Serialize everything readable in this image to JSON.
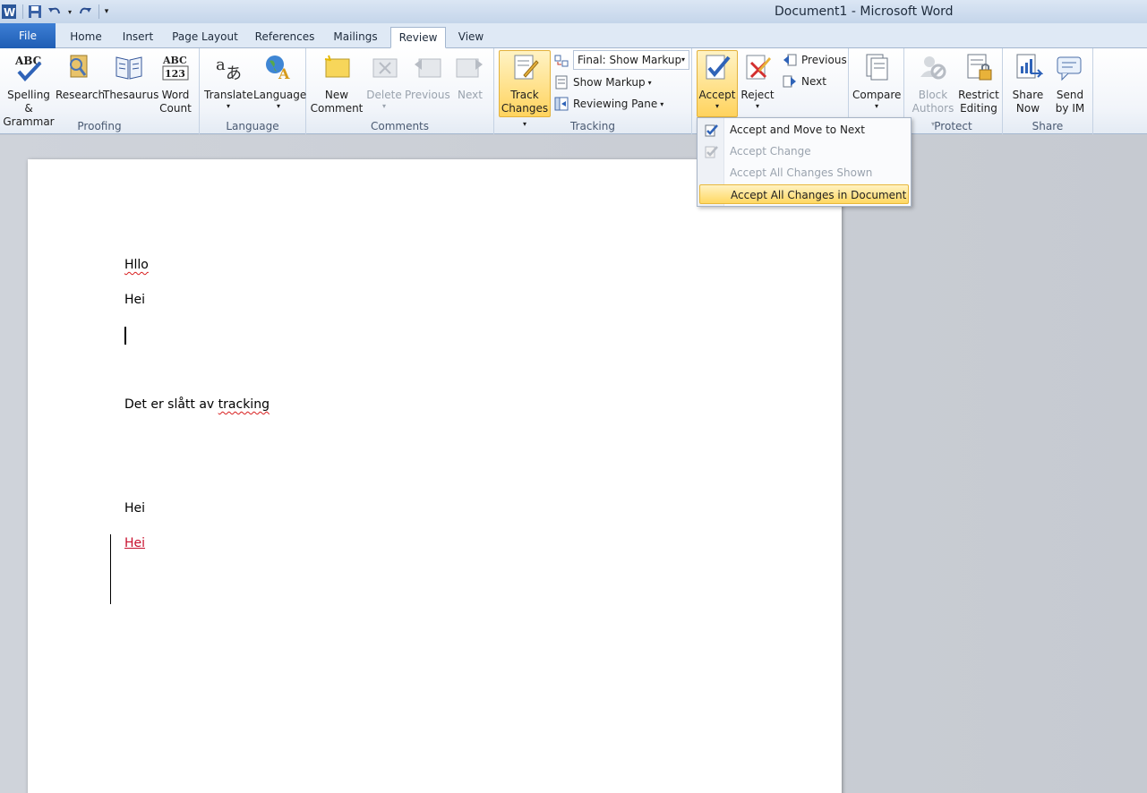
{
  "app": {
    "title": "Document1  -  Microsoft Word"
  },
  "tabs": [
    {
      "label": "File"
    },
    {
      "label": "Home"
    },
    {
      "label": "Insert"
    },
    {
      "label": "Page Layout"
    },
    {
      "label": "References"
    },
    {
      "label": "Mailings"
    },
    {
      "label": "Review"
    },
    {
      "label": "View"
    }
  ],
  "active_tab": "Review",
  "groups": {
    "proofing": {
      "label": "Proofing",
      "spelling": {
        "line1": "Spelling &",
        "line2": "Grammar"
      },
      "research": "Research",
      "thesaurus": "Thesaurus",
      "wordcount": {
        "line1": "Word",
        "line2": "Count"
      }
    },
    "language": {
      "label": "Language",
      "translate": "Translate",
      "language": "Language"
    },
    "comments": {
      "label": "Comments",
      "new": {
        "line1": "New",
        "line2": "Comment"
      },
      "delete": "Delete",
      "previous": "Previous",
      "next": "Next"
    },
    "tracking": {
      "label": "Tracking",
      "track": {
        "line1": "Track",
        "line2": "Changes"
      },
      "display_combo": "Final: Show Markup",
      "show_markup": "Show Markup",
      "reviewing_pane": "Reviewing Pane"
    },
    "changes": {
      "accept": "Accept",
      "reject": "Reject",
      "previous": "Previous",
      "next": "Next"
    },
    "compare": {
      "compare": "Compare"
    },
    "protect": {
      "label": "Protect",
      "block": {
        "line1": "Block",
        "line2": "Authors"
      },
      "restrict": {
        "line1": "Restrict",
        "line2": "Editing"
      }
    },
    "share": {
      "label": "Share",
      "share_now": {
        "line1": "Share",
        "line2": "Now"
      },
      "send_im": {
        "line1": "Send",
        "line2": "by IM"
      }
    }
  },
  "accept_menu": {
    "items": [
      {
        "label": "Accept and Move to Next",
        "enabled": true
      },
      {
        "label": "Accept Change",
        "enabled": false
      },
      {
        "label": "Accept All Changes Shown",
        "enabled": false
      },
      {
        "label": "Accept All Changes in Document",
        "enabled": true,
        "highlighted": true
      }
    ]
  },
  "document": {
    "paragraphs": [
      "Hllo",
      "Hei",
      "Det er slått av ",
      "tracking",
      "Hei",
      "Hei"
    ]
  },
  "colors": {
    "accent": "#2b579a",
    "inserted_text": "#c8102e",
    "highlight": "#ffd862"
  }
}
